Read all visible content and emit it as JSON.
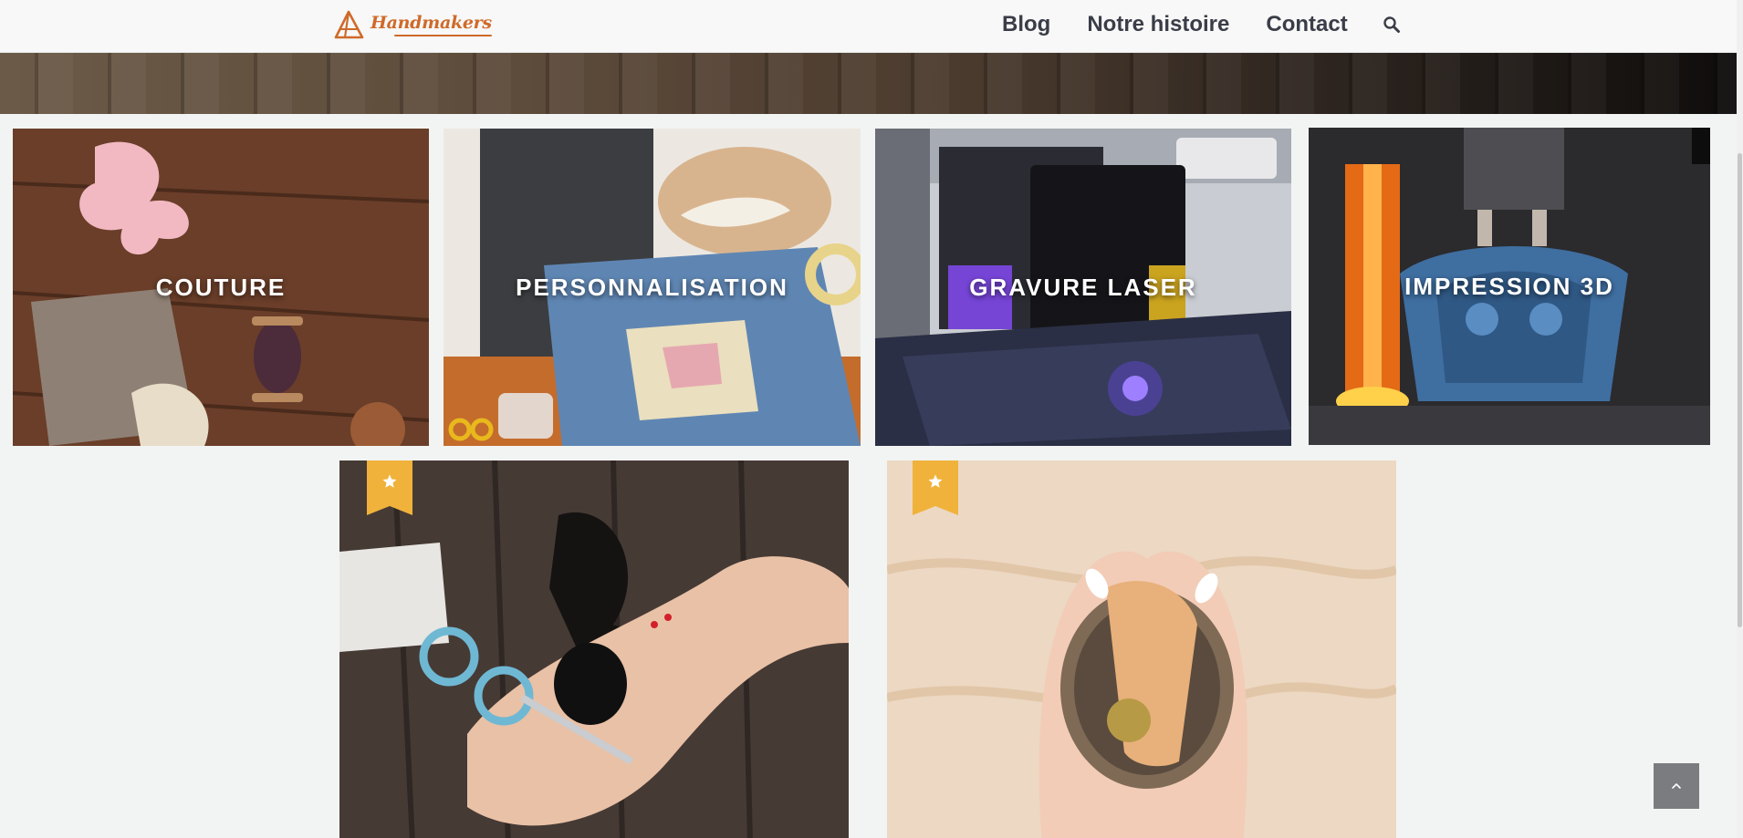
{
  "header": {
    "logo_text": "Handmakers",
    "nav": [
      {
        "label": "Blog"
      },
      {
        "label": "Notre histoire"
      },
      {
        "label": "Contact"
      }
    ],
    "search_icon": "search-icon"
  },
  "categories": [
    {
      "label": "COUTURE"
    },
    {
      "label": "PERSONNALISATION"
    },
    {
      "label": "GRAVURE LASER"
    },
    {
      "label": "IMPRESSION 3D"
    }
  ],
  "featured": {
    "ribbon_icon": "star-icon",
    "ribbon_color": "#f0b23b"
  },
  "colors": {
    "logo": "#cf6a2a",
    "nav_text": "#3a3d48",
    "to_top_bg": "#7a7c80"
  },
  "back_to_top_icon": "chevron-up-icon"
}
